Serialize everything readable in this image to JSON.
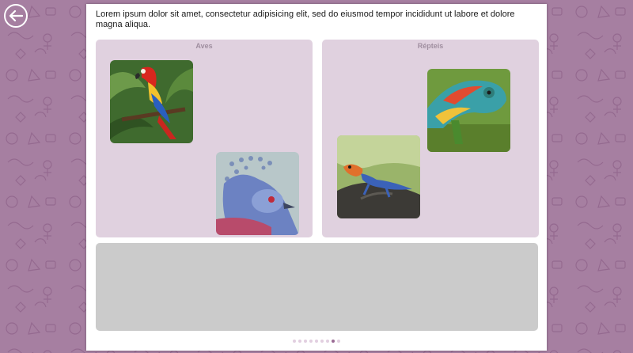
{
  "instruction": "Lorem ipsum dolor sit amet, consectetur adipisicing elit, sed do eiusmod tempor incididunt ut labore et dolore magna aliqua.",
  "categories": [
    {
      "title": "Aves",
      "cards": [
        "macaw-photo",
        "crowned-pigeon-photo"
      ]
    },
    {
      "title": "Répteis",
      "cards": [
        "chameleon-photo",
        "agama-lizard-photo"
      ]
    }
  ],
  "icons": {
    "back": "arrow-left-icon"
  },
  "pager": {
    "total_pages": 9,
    "current_page": 8
  },
  "colors": {
    "background": "#a67fa1",
    "category_box": "#e0d1df",
    "drop_pool": "#cbcbcb",
    "category_title": "#a08fa0",
    "dot_active": "#9a6a94",
    "dot_inactive": "#e2cfe0"
  }
}
